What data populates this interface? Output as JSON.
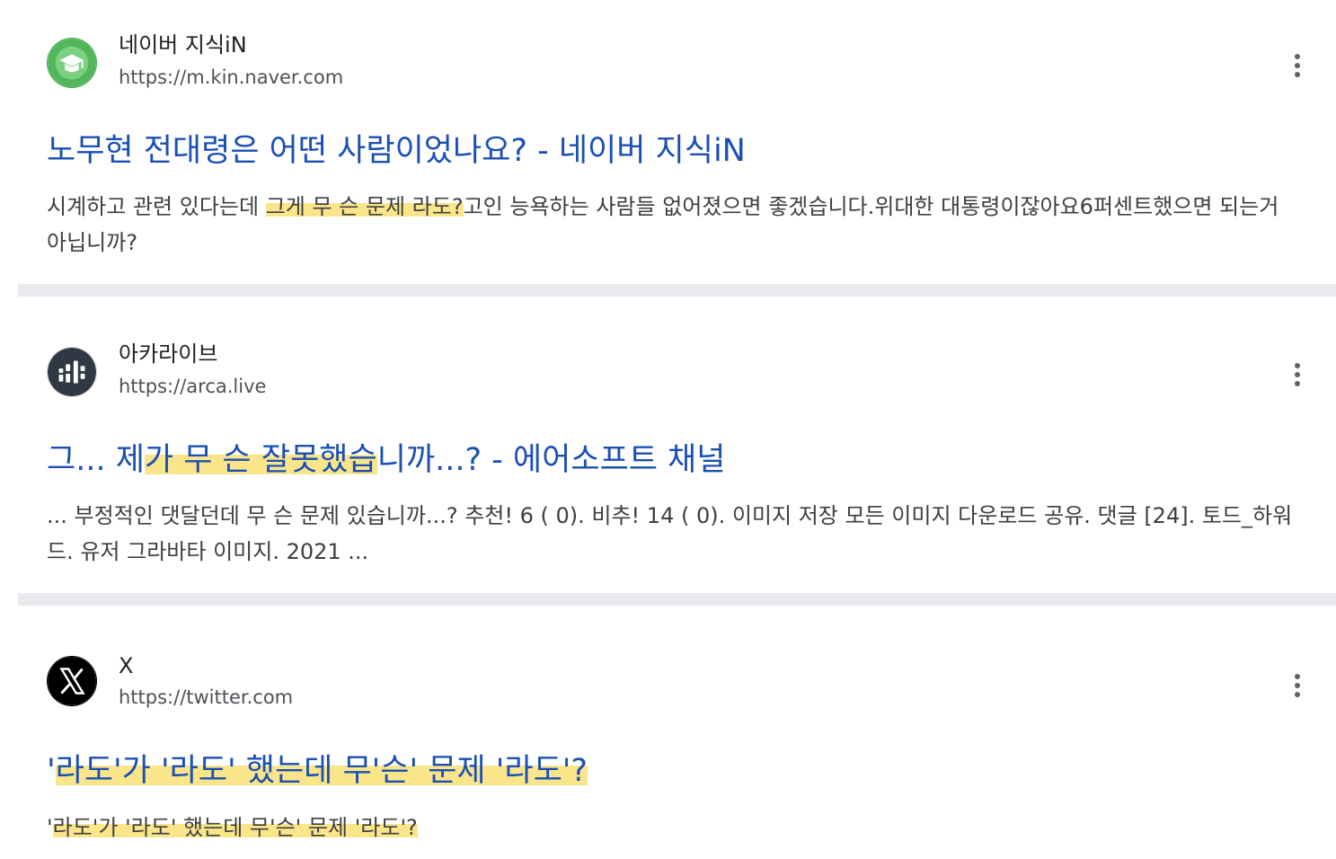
{
  "results": [
    {
      "site_name": "네이버 지식iN",
      "url": "https://m.kin.naver.com",
      "favicon": "graduation-cap-icon",
      "favicon_color": "#4caf50",
      "title": "노무현 전대령은 어떤 사람이었나요? - 네이버 지식iN",
      "snippet_pre": "시계하고 관련 있다는데 ",
      "snippet_hl": "그게 무 슨 문제 라도?",
      "snippet_post": "고인 능욕하는 사람들 없어졌으면 좋겠습니다.위대한 대통령이잖아요6퍼센트했으면 되는거 아닙니까?"
    },
    {
      "site_name": "아카라이브",
      "url": "https://arca.live",
      "favicon": "arca-logo-icon",
      "favicon_color": "#37404a",
      "title_pre": "그... 제",
      "title_hl": "가 무 슨 잘못했습",
      "title_post": "니까...? - 에어소프트 채널",
      "snippet": "... 부정적인 댓달던데 무 슨 문제 있습니까...? 추천! 6 ( 0). 비추! 14 ( 0). 이미지 저장 모든 이미지 다운로드 공유. 댓글 [24]. 토드_하워드. 유저 그라바타 이미지. 2021 ..."
    },
    {
      "site_name": "X",
      "url": "https://twitter.com",
      "favicon": "x-logo-icon",
      "favicon_color": "#000000",
      "title_pre": "'",
      "title_hl": "라도'가 '라도' 했는데 무'슨' 문제 '라도'?",
      "snippet_pre": "'",
      "snippet_hl": "라도'가 '라도' 했는데 무'슨' 문제 '라도'?"
    }
  ],
  "more_icon": "more-vert-icon",
  "colors": {
    "link": "#1a4fb4",
    "highlight": "#fbe58a",
    "divider": "#e8eaed"
  }
}
